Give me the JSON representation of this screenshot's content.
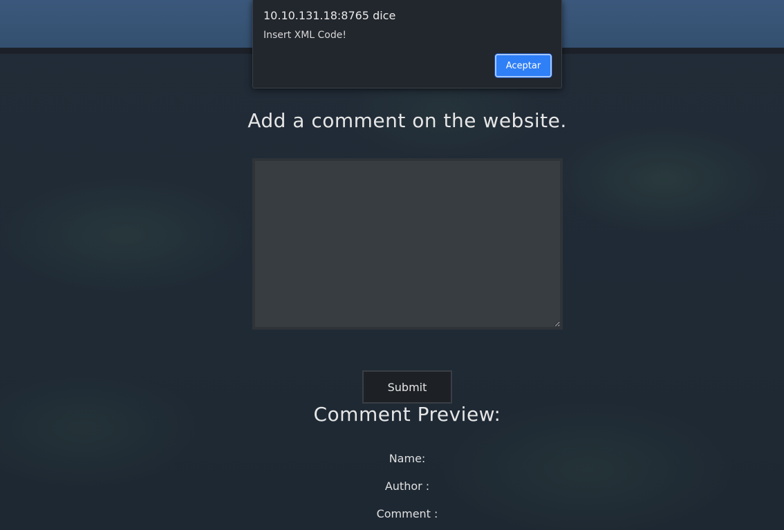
{
  "dialog": {
    "origin": "10.10.131.18:8765 dice",
    "message": "Insert XML Code!",
    "ok_label": "Aceptar"
  },
  "main": {
    "heading": "Add a comment on the website.",
    "textarea_value": "",
    "submit_label": "Submit"
  },
  "preview": {
    "title": "Comment Preview:",
    "name_label": "Name:",
    "author_label": "Author :",
    "comment_label": "Comment :"
  },
  "colors": {
    "navbar": "#34506f",
    "background": "#1f2833",
    "dialog_button": "#2f7ff7"
  }
}
